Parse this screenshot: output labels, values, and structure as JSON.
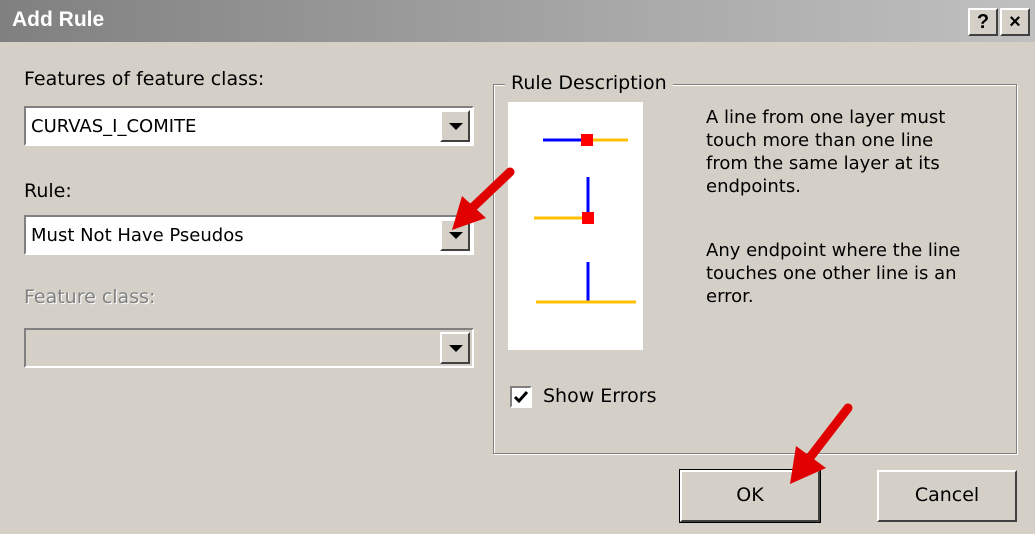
{
  "window": {
    "title": "Add Rule",
    "help_label": "?",
    "close_label": "×"
  },
  "features": {
    "label": "Features of feature class:",
    "value": "CURVAS_I_COMITE"
  },
  "rule": {
    "label": "Rule:",
    "value": "Must Not Have Pseudos"
  },
  "feature_class": {
    "label": "Feature class:",
    "value": ""
  },
  "rule_description": {
    "legend": "Rule Description",
    "lines1": [
      "A line from one layer must",
      "touch more than one line",
      "from the same layer at its",
      "endpoints."
    ],
    "lines2": [
      "Any endpoint where the line",
      "touches one other line is an",
      "error."
    ]
  },
  "show_errors": {
    "label": "Show Errors",
    "checked": true
  },
  "buttons": {
    "ok": "OK",
    "cancel": "Cancel"
  },
  "colors": {
    "blue": "#0000ff",
    "yellow": "#ffc000",
    "red": "#ff0000"
  }
}
